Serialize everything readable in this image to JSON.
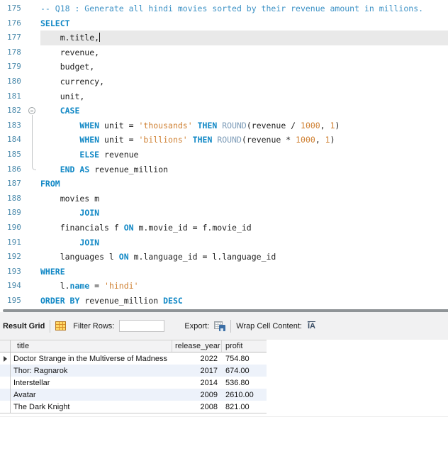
{
  "colors": {
    "keyword": "#0f87c5",
    "comment": "#3f93c6",
    "string_number": "#cf8032",
    "function": "#7d9cb8",
    "identifier": "#1f1f1f",
    "line_number": "#4e8cad",
    "current_line_bg": "#e9e9e9",
    "alt_row_bg": "#edf2fa"
  },
  "editor": {
    "lines": [
      {
        "num": "175",
        "segments": [
          [
            "cm",
            "-- Q18 : Generate all hindi movies sorted by their revenue amount in millions."
          ]
        ]
      },
      {
        "num": "176",
        "segments": [
          [
            "kw",
            "SELECT"
          ]
        ]
      },
      {
        "num": "177",
        "current": true,
        "cursor": true,
        "segments": [
          [
            "id",
            "    m.title,"
          ]
        ]
      },
      {
        "num": "178",
        "segments": [
          [
            "id",
            "    revenue,"
          ]
        ]
      },
      {
        "num": "179",
        "segments": [
          [
            "id",
            "    budget,"
          ]
        ]
      },
      {
        "num": "180",
        "segments": [
          [
            "id",
            "    currency,"
          ]
        ]
      },
      {
        "num": "181",
        "segments": [
          [
            "id",
            "    unit,"
          ]
        ]
      },
      {
        "num": "182",
        "fold": "start",
        "segments": [
          [
            "id",
            "    "
          ],
          [
            "kw",
            "CASE"
          ]
        ]
      },
      {
        "num": "183",
        "fold": "mid",
        "segments": [
          [
            "id",
            "        "
          ],
          [
            "kw",
            "WHEN"
          ],
          [
            "id",
            " unit = "
          ],
          [
            "str",
            "'thousands'"
          ],
          [
            "id",
            " "
          ],
          [
            "kw",
            "THEN"
          ],
          [
            "id",
            " "
          ],
          [
            "fn",
            "ROUND"
          ],
          [
            "id",
            "(revenue / "
          ],
          [
            "num",
            "1000"
          ],
          [
            "id",
            ", "
          ],
          [
            "num",
            "1"
          ],
          [
            "id",
            ")"
          ]
        ]
      },
      {
        "num": "184",
        "fold": "mid",
        "segments": [
          [
            "id",
            "        "
          ],
          [
            "kw",
            "WHEN"
          ],
          [
            "id",
            " unit = "
          ],
          [
            "str",
            "'billions'"
          ],
          [
            "id",
            " "
          ],
          [
            "kw",
            "THEN"
          ],
          [
            "id",
            " "
          ],
          [
            "fn",
            "ROUND"
          ],
          [
            "id",
            "(revenue * "
          ],
          [
            "num",
            "1000"
          ],
          [
            "id",
            ", "
          ],
          [
            "num",
            "1"
          ],
          [
            "id",
            ")"
          ]
        ]
      },
      {
        "num": "185",
        "fold": "mid",
        "segments": [
          [
            "id",
            "        "
          ],
          [
            "kw",
            "ELSE"
          ],
          [
            "id",
            " revenue"
          ]
        ]
      },
      {
        "num": "186",
        "fold": "end",
        "segments": [
          [
            "id",
            "    "
          ],
          [
            "kw",
            "END"
          ],
          [
            "id",
            " "
          ],
          [
            "kw",
            "AS"
          ],
          [
            "id",
            " revenue_million"
          ]
        ]
      },
      {
        "num": "187",
        "segments": [
          [
            "kw",
            "FROM"
          ]
        ]
      },
      {
        "num": "188",
        "segments": [
          [
            "id",
            "    movies m"
          ]
        ]
      },
      {
        "num": "189",
        "segments": [
          [
            "id",
            "        "
          ],
          [
            "kw",
            "JOIN"
          ]
        ]
      },
      {
        "num": "190",
        "segments": [
          [
            "id",
            "    financials f "
          ],
          [
            "kw",
            "ON"
          ],
          [
            "id",
            " m.movie_id = f.movie_id"
          ]
        ]
      },
      {
        "num": "191",
        "segments": [
          [
            "id",
            "        "
          ],
          [
            "kw",
            "JOIN"
          ]
        ]
      },
      {
        "num": "192",
        "segments": [
          [
            "id",
            "    languages l "
          ],
          [
            "kw",
            "ON"
          ],
          [
            "id",
            " m.language_id = l.language_id"
          ]
        ]
      },
      {
        "num": "193",
        "segments": [
          [
            "kw",
            "WHERE"
          ]
        ]
      },
      {
        "num": "194",
        "segments": [
          [
            "id",
            "    l."
          ],
          [
            "kw",
            "name"
          ],
          [
            "id",
            " = "
          ],
          [
            "str",
            "'hindi'"
          ]
        ]
      },
      {
        "num": "195",
        "segments": [
          [
            "kw",
            "ORDER BY"
          ],
          [
            "id",
            " revenue_million "
          ],
          [
            "kw",
            "DESC"
          ]
        ]
      }
    ]
  },
  "result_grid": {
    "toolbar": {
      "title": "Result Grid",
      "filter_label": "Filter Rows:",
      "filter_value": "",
      "export_label": "Export:",
      "wrap_label": "Wrap Cell Content:",
      "wrap_icon_glyph": "ĪA"
    },
    "columns": [
      "title",
      "release_year",
      "profit"
    ],
    "marker_row_index": 0,
    "rows": [
      [
        "Doctor Strange in the Multiverse of Madness",
        "2022",
        "754.80"
      ],
      [
        "Thor: Ragnarok",
        "2017",
        "674.00"
      ],
      [
        "Interstellar",
        "2014",
        "536.80"
      ],
      [
        "Avatar",
        "2009",
        "2610.00"
      ],
      [
        "The Dark Knight",
        "2008",
        "821.00"
      ]
    ]
  }
}
